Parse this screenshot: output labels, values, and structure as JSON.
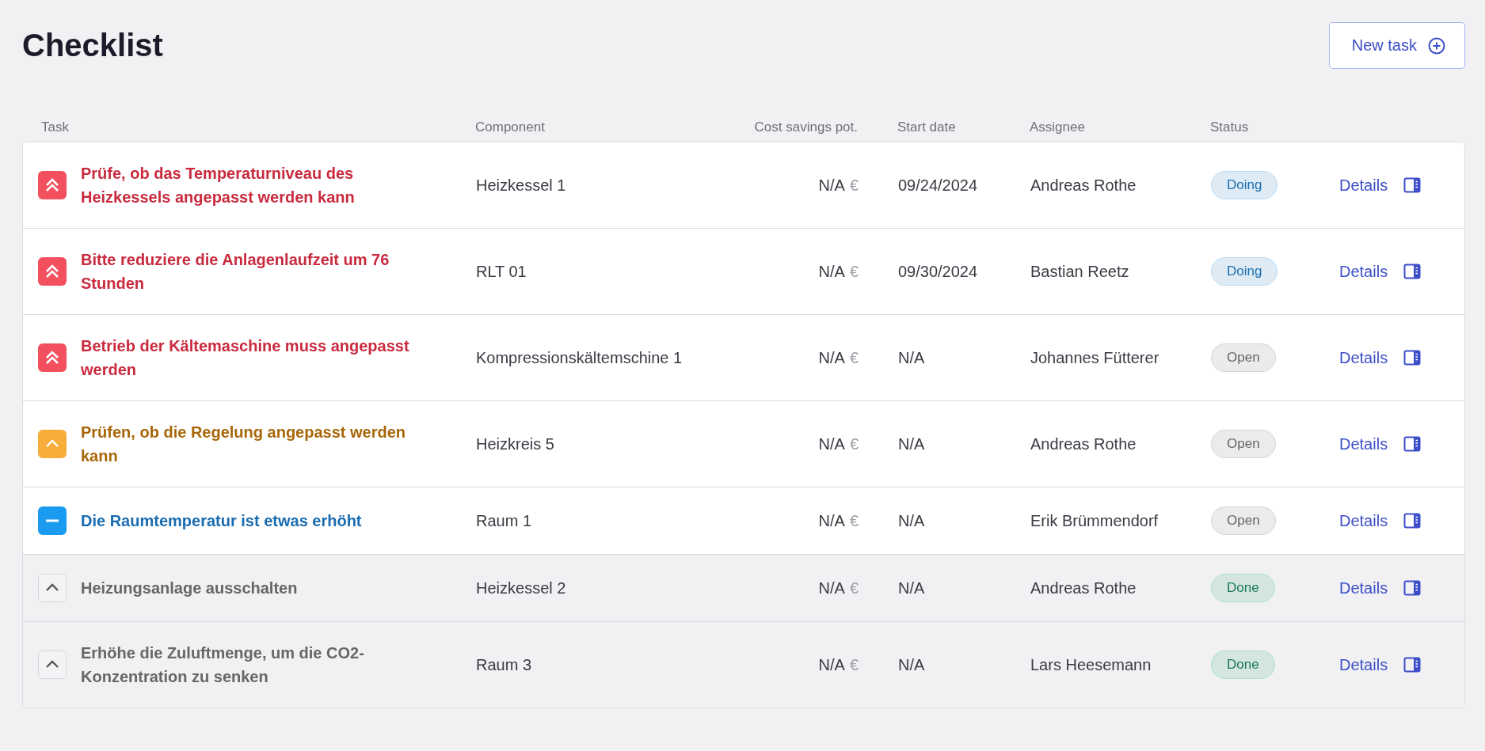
{
  "title": "Checklist",
  "new_task_button": "New task",
  "columns": [
    "Task",
    "Component",
    "Cost savings pot.",
    "Start date",
    "Assignee",
    "Status"
  ],
  "rows": [
    {
      "task": "Prüfe, ob das Temperaturniveau des Heizkessels angepasst werden kann",
      "kind": "high",
      "component": "Heizkessel 1",
      "cost": "N/A",
      "currency": "€",
      "start_date": "09/24/2024",
      "assignee": "Andreas Rothe",
      "status": {
        "label": "Doing",
        "kind": "doing"
      },
      "action": "Details"
    },
    {
      "task": "Bitte reduziere die Anlagenlaufzeit um 76 Stunden",
      "kind": "high",
      "component": "RLT 01",
      "cost": "N/A",
      "currency": "€",
      "start_date": "09/30/2024",
      "assignee": "Bastian Reetz",
      "status": {
        "label": "Doing",
        "kind": "doing"
      },
      "action": "Details"
    },
    {
      "task": "Betrieb der Kältemaschine muss angepasst werden",
      "kind": "high",
      "component": "Kompressionskältemschine 1",
      "cost": "N/A",
      "currency": "€",
      "start_date": "N/A",
      "assignee": "Johannes Fütterer",
      "status": {
        "label": "Open",
        "kind": "open"
      },
      "action": "Details"
    },
    {
      "task": "Prüfen, ob die Regelung angepasst werden kann",
      "kind": "medium",
      "component": "Heizkreis 5",
      "cost": "N/A",
      "currency": "€",
      "start_date": "N/A",
      "assignee": "Andreas Rothe",
      "status": {
        "label": "Open",
        "kind": "open"
      },
      "action": "Details"
    },
    {
      "task": "Die Raumtemperatur ist etwas erhöht",
      "kind": "low",
      "component": "Raum 1",
      "cost": "N/A",
      "currency": "€",
      "start_date": "N/A",
      "assignee": "Erik Brümmendorf",
      "status": {
        "label": "Open",
        "kind": "open"
      },
      "action": "Details"
    },
    {
      "task": "Heizungsanlage ausschalten",
      "kind": "medium",
      "component": "Heizkessel 2",
      "cost": "N/A",
      "currency": "€",
      "start_date": "N/A",
      "assignee": "Andreas Rothe",
      "status": {
        "label": "Done",
        "kind": "done"
      },
      "action": "Details"
    },
    {
      "task": "Erhöhe die Zuluftmenge, um die CO2-Konzentration zu senken",
      "kind": "medium",
      "component": "Raum 3",
      "cost": "N/A",
      "currency": "€",
      "start_date": "N/A",
      "assignee": "Lars Heesemann",
      "status": {
        "label": "Done",
        "kind": "done"
      },
      "action": "Details"
    }
  ]
}
